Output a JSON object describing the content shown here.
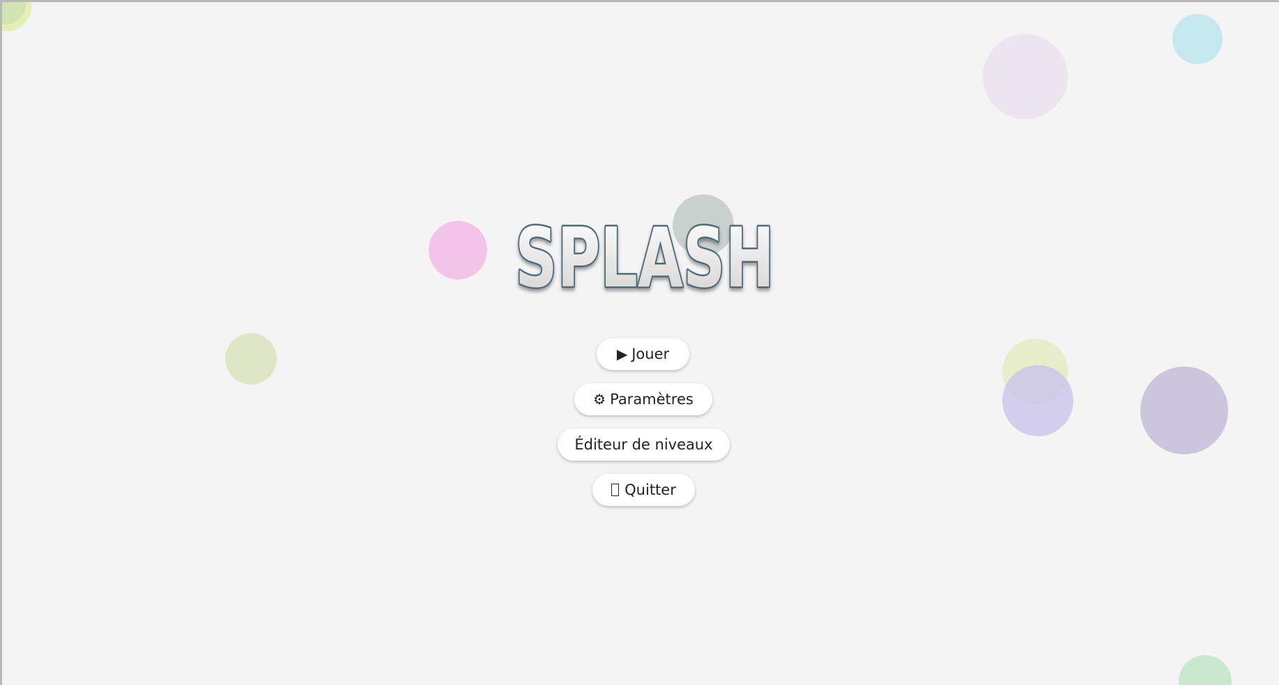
{
  "title": "SPLASH",
  "menu": {
    "play": {
      "icon": "▶",
      "label": "Jouer"
    },
    "settings": {
      "icon": "⚙",
      "label": "Paramètres"
    },
    "editor": {
      "label": "Éditeur de niveaux"
    },
    "quit": {
      "icon": "missing-glyph-box-icon",
      "label": "Quitter"
    }
  },
  "colors": {
    "background": "#f4f4f4",
    "button_bg": "#ffffff",
    "button_text": "#222222",
    "logo_outline": "#4d6a78",
    "logo_fill_top": "#ffffff",
    "logo_fill_bottom": "#d4d2cf"
  },
  "decorative_bubbles": [
    {
      "color": "#e3f0b4"
    },
    {
      "color": "#cfe0c2"
    },
    {
      "color": "#ece4ee"
    },
    {
      "color": "#c5e8ee"
    },
    {
      "color": "#f4c3e8"
    },
    {
      "color": "#c9d1ce"
    },
    {
      "color": "#dde7c5"
    },
    {
      "color": "#e7ecc9"
    },
    {
      "color": "#d6d0eb"
    },
    {
      "color": "#cbc6de"
    },
    {
      "color": "#c8e8cf"
    }
  ]
}
